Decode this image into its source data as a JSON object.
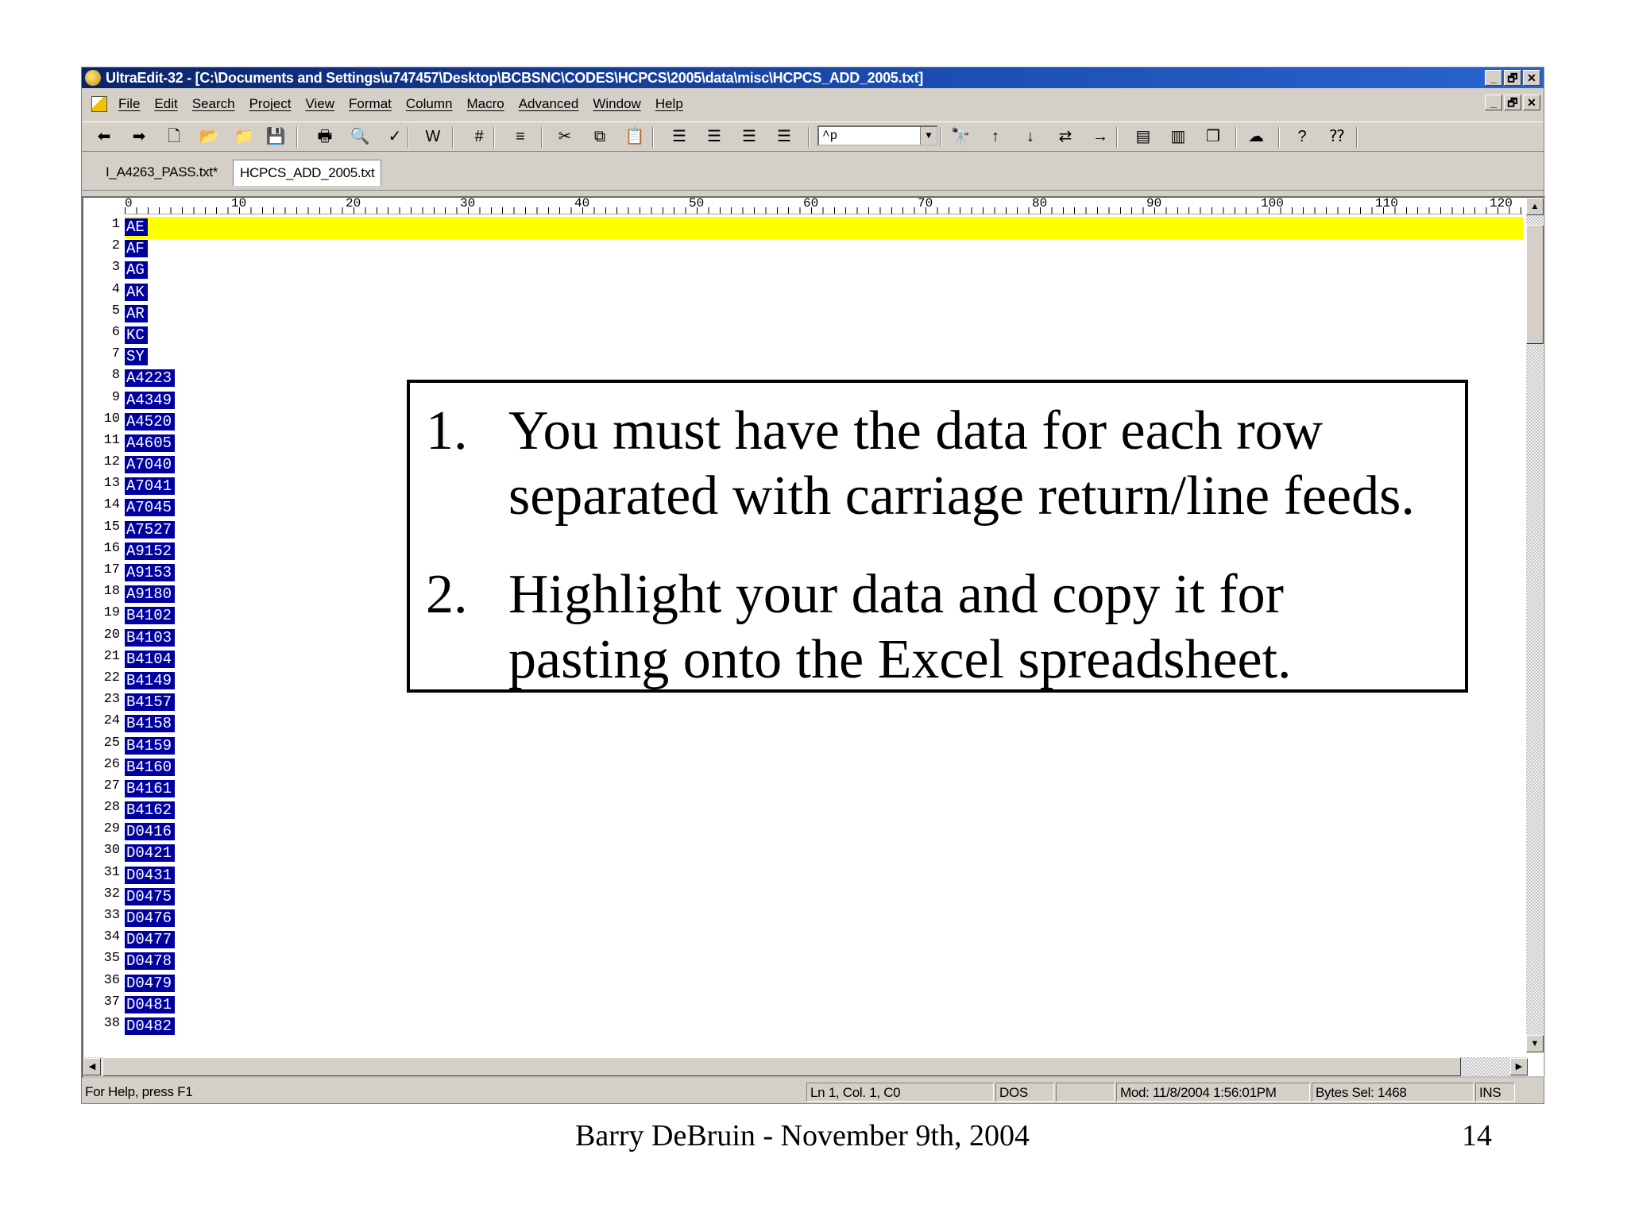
{
  "window": {
    "title": "UltraEdit-32 - [C:\\Documents and Settings\\u747457\\Desktop\\BCBSNC\\CODES\\HCPCS\\2005\\data\\misc\\HCPCS_ADD_2005.txt]",
    "caption_buttons": [
      "_",
      "🗗",
      "✕"
    ]
  },
  "menu": {
    "items": [
      "File",
      "Edit",
      "Search",
      "Project",
      "View",
      "Format",
      "Column",
      "Macro",
      "Advanced",
      "Window",
      "Help"
    ]
  },
  "toolbar": {
    "search_combo_value": "^p",
    "icons": [
      "back-icon",
      "forward-icon",
      "new-file-icon",
      "open-icon",
      "open-folder-icon",
      "save-icon",
      "print-icon",
      "print-preview-icon",
      "spell-check-icon",
      "word-wrap-icon",
      "hex-mode-icon",
      "format-icon",
      "cut-icon",
      "copy-icon",
      "paste-icon",
      "align-left-icon",
      "align-center-icon",
      "align-right-icon",
      "justify-icon",
      "find-icon",
      "find-prev-icon",
      "find-next-icon",
      "replace-icon",
      "goto-icon",
      "split-h-icon",
      "split-v-icon",
      "cascade-icon",
      "ftp-icon",
      "help-icon",
      "context-help-icon"
    ]
  },
  "tabs": [
    "I_A4263_PASS.txt*",
    "HCPCS_ADD_2005.txt"
  ],
  "ruler": [
    "0",
    "10",
    "20",
    "30",
    "40",
    "50",
    "60",
    "70",
    "80",
    "90",
    "100",
    "110",
    "120"
  ],
  "lines": [
    "AE",
    "AF",
    "AG",
    "AK",
    "AR",
    "KC",
    "SY",
    "A4223",
    "A4349",
    "A4520",
    "A4605",
    "A7040",
    "A7041",
    "A7045",
    "A7527",
    "A9152",
    "A9153",
    "A9180",
    "B4102",
    "B4103",
    "B4104",
    "B4149",
    "B4157",
    "B4158",
    "B4159",
    "B4160",
    "B4161",
    "B4162",
    "D0416",
    "D0421",
    "D0431",
    "D0475",
    "D0476",
    "D0477",
    "D0478",
    "D0479",
    "D0481",
    "D0482"
  ],
  "line_numbers": [
    "1",
    "2",
    "3",
    "4",
    "5",
    "6",
    "7",
    "8",
    "9",
    "10",
    "11",
    "12",
    "13",
    "14",
    "15",
    "16",
    "17",
    "18",
    "19",
    "20",
    "21",
    "22",
    "23",
    "24",
    "25",
    "26",
    "27",
    "28",
    "29",
    "30",
    "31",
    "32",
    "33",
    "34",
    "35",
    "36",
    "37",
    "38"
  ],
  "status": {
    "help": "For Help, press F1",
    "position": "Ln 1, Col. 1, C0",
    "format": "DOS",
    "modified": "Mod: 11/8/2004 1:56:01PM",
    "bytes": "Bytes Sel: 1468",
    "mode": "INS"
  },
  "callout": {
    "items": [
      {
        "num": "1.",
        "text": "You must have the data for each row separated with carriage return/line feeds."
      },
      {
        "num": "2.",
        "text": "Highlight your data and copy it for pasting onto the Excel spreadsheet."
      }
    ]
  },
  "footer": {
    "author": "Barry DeBruin - November 9th, 2004",
    "page": "14"
  },
  "colors": {
    "titlebar": "#0a246a",
    "selection": "#0000a0",
    "current_line": "#ffff00"
  }
}
